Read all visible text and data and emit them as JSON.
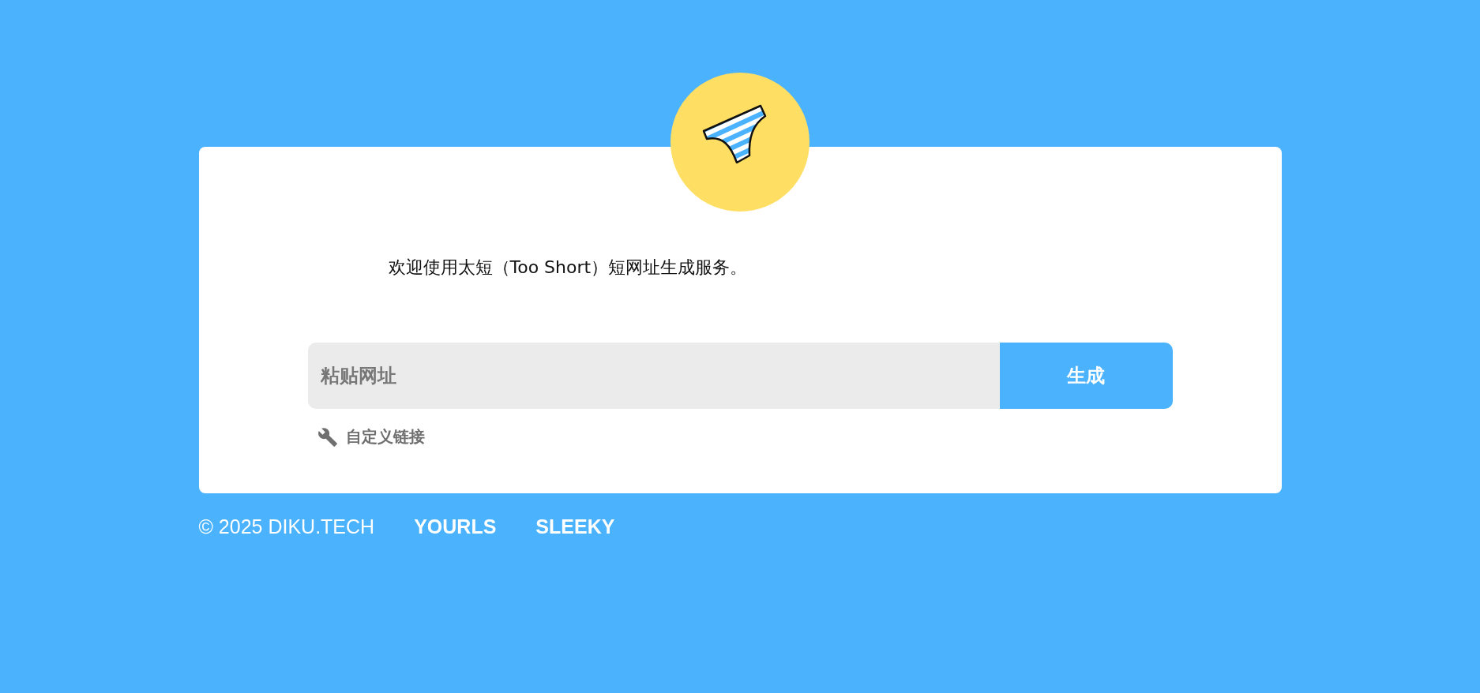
{
  "welcome": "欢迎使用太短（Too Short）短网址生成服务。",
  "url_field": {
    "placeholder": "粘贴网址"
  },
  "generate_button": "生成",
  "custom_link": "自定义链接",
  "footer": {
    "copyright": "© 2025 DIKU.TECH",
    "links": [
      "YOURLS",
      "SLEEKY"
    ]
  }
}
